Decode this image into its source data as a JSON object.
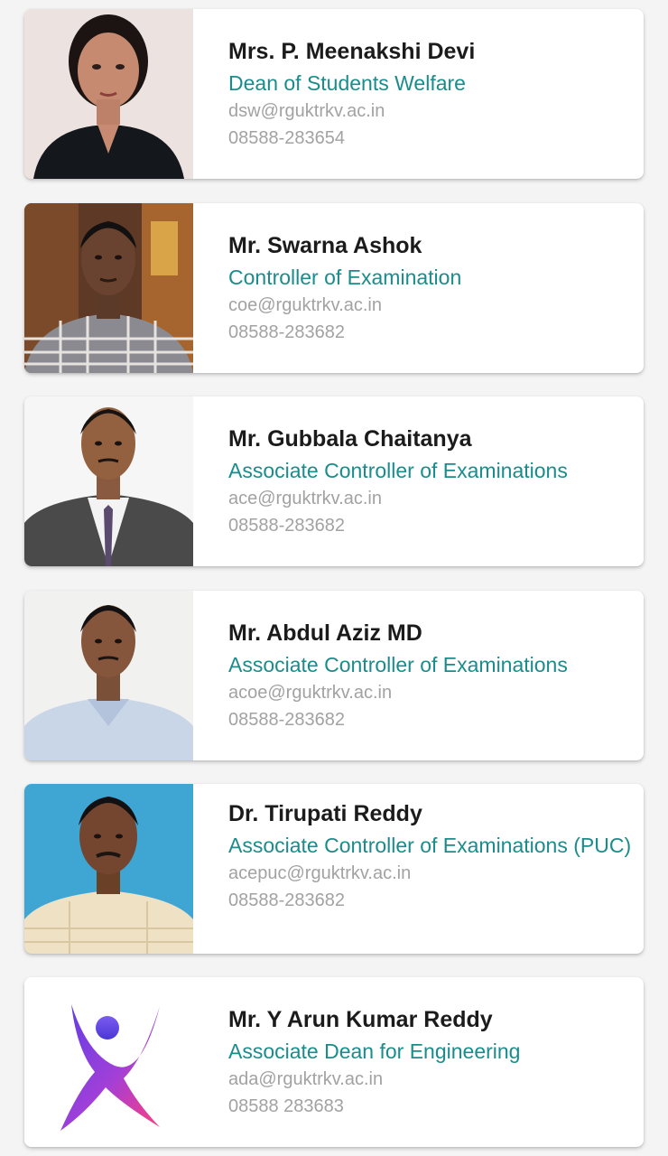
{
  "people": [
    {
      "name": "Mrs. P. Meenakshi Devi",
      "role": "Dean of Students Welfare",
      "email": "dsw@rguktrkv.ac.in",
      "phone": "08588-283654",
      "photo_icon": "person-photo"
    },
    {
      "name": "Mr. Swarna Ashok",
      "role": "Controller of Examination",
      "email": "coe@rguktrkv.ac.in",
      "phone": "08588-283682",
      "photo_icon": "person-photo"
    },
    {
      "name": "Mr. Gubbala Chaitanya",
      "role": "Associate Controller of Examinations",
      "email": "ace@rguktrkv.ac.in",
      "phone": "08588-283682",
      "photo_icon": "person-photo"
    },
    {
      "name": "Mr. Abdul Aziz MD",
      "role": "Associate Controller of Examinations",
      "email": "acoe@rguktrkv.ac.in",
      "phone": "08588-283682",
      "photo_icon": "person-photo"
    },
    {
      "name": "Dr. Tirupati Reddy",
      "role": "Associate Controller of Examinations (PUC)",
      "email": "acepuc@rguktrkv.ac.in",
      "phone": "08588-283682",
      "photo_icon": "person-photo"
    },
    {
      "name": "Mr. Y Arun Kumar Reddy",
      "role": "Associate Dean for Engineering",
      "email": "ada@rguktrkv.ac.in",
      "phone": "08588 283683",
      "photo_icon": "placeholder-person-logo-icon"
    }
  ],
  "colors": {
    "role_text": "#1a8c8c",
    "muted_text": "#a2a2a2",
    "name_text": "#1b1b1b"
  }
}
